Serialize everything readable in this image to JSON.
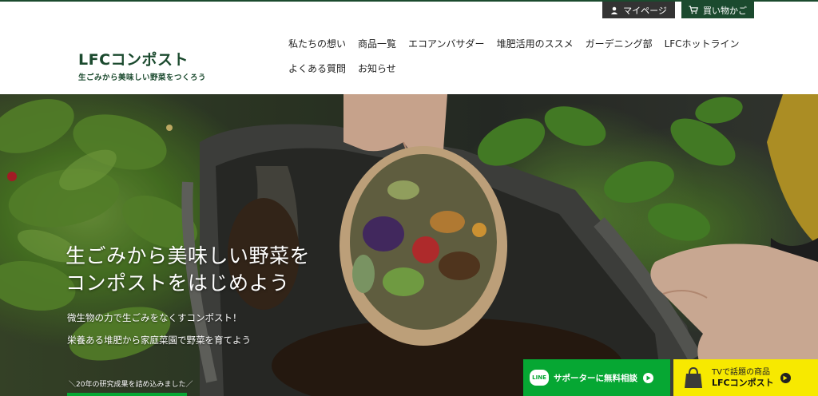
{
  "header": {
    "mypage_label": "マイページ",
    "cart_label": "買い物かご",
    "logo_title": "LFCコンポスト",
    "logo_sub": "生ごみから美味しい野菜をつくろう"
  },
  "nav": {
    "row1": [
      "私たちの想い",
      "商品一覧",
      "エコアンバサダー",
      "堆肥活用のススメ",
      "ガーデニング部",
      "LFCホットライン"
    ],
    "row2": [
      "よくある質問",
      "お知らせ"
    ]
  },
  "hero": {
    "headline_line1": "生ごみから美味しい野菜を",
    "headline_line2": "コンポストをはじめよう",
    "sub_line1": "微生物の力で生ごみをなくすコンポスト！",
    "sub_line2": "栄養ある堆肥から家庭菜園で野菜を育てよう",
    "note": "＼20年の研究成果を詰め込みました／"
  },
  "cta": {
    "line_badge": "LINE",
    "line_label": "サポーターに無料相談",
    "tv_sub": "TVで話題の商品",
    "tv_main": "LFCコンポスト"
  },
  "colors": {
    "brand_green": "#1b4a2e",
    "line_green": "#06a733",
    "tv_yellow": "#f7e900",
    "mypage_gray": "#333333"
  },
  "icons": {
    "mypage": "user-icon",
    "cart": "cart-icon",
    "line_arrow": "play-arrow-icon",
    "tv_bag": "bag-icon"
  }
}
